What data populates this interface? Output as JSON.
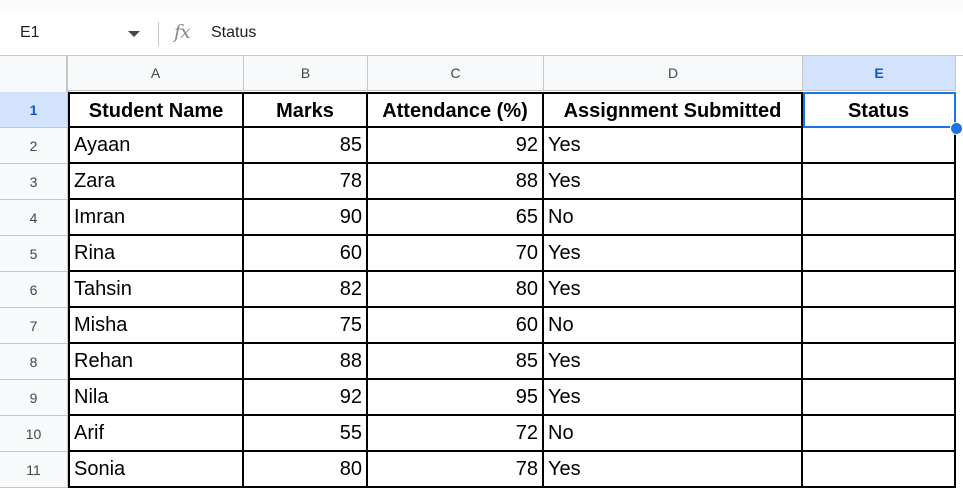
{
  "formula_bar": {
    "name_box": "E1",
    "fx_label": "fx",
    "formula": "Status"
  },
  "columns": [
    "A",
    "B",
    "C",
    "D",
    "E"
  ],
  "selected_column": "E",
  "selected_row": "1",
  "rows": [
    "1",
    "2",
    "3",
    "4",
    "5",
    "6",
    "7",
    "8",
    "9",
    "10",
    "11"
  ],
  "table": {
    "headers": [
      "Student Name",
      "Marks",
      "Attendance (%)",
      "Assignment Submitted",
      "Status"
    ],
    "data": [
      [
        "Ayaan",
        "85",
        "92",
        "Yes",
        ""
      ],
      [
        "Zara",
        "78",
        "88",
        "Yes",
        ""
      ],
      [
        "Imran",
        "90",
        "65",
        "No",
        ""
      ],
      [
        "Rina",
        "60",
        "70",
        "Yes",
        ""
      ],
      [
        "Tahsin",
        "82",
        "80",
        "Yes",
        ""
      ],
      [
        "Misha",
        "75",
        "60",
        "No",
        ""
      ],
      [
        "Rehan",
        "88",
        "85",
        "Yes",
        ""
      ],
      [
        "Nila",
        "92",
        "95",
        "Yes",
        ""
      ],
      [
        "Arif",
        "55",
        "72",
        "No",
        ""
      ],
      [
        "Sonia",
        "80",
        "78",
        "Yes",
        ""
      ]
    ]
  },
  "colors": {
    "selection": "#1a73e8",
    "header_bg": "#f8f9fa",
    "selected_header_bg": "#d3e3fd"
  }
}
